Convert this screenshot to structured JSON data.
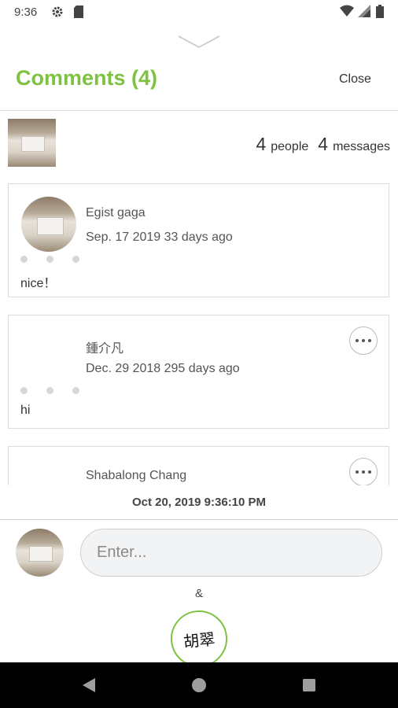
{
  "status_bar": {
    "time": "9:36"
  },
  "header": {
    "title": "Comments (4)",
    "close_label": "Close"
  },
  "summary": {
    "people_count": "4",
    "people_label": "people",
    "messages_count": "4",
    "messages_label": "messages"
  },
  "comments": [
    {
      "author": "Egist gaga",
      "date": "Sep. 17 2019 33 days ago",
      "text": "nice！"
    },
    {
      "author": "鍾介凡",
      "date": "Dec. 29 2018 295 days ago",
      "text": "hi"
    },
    {
      "author": "Shabalong Chang"
    }
  ],
  "footer": {
    "timestamp": "Oct 20, 2019 9:36:10 PM",
    "input_placeholder": "Enter...",
    "separator": "&",
    "logo_text": "胡翠"
  },
  "colors": {
    "accent": "#7ec242"
  }
}
